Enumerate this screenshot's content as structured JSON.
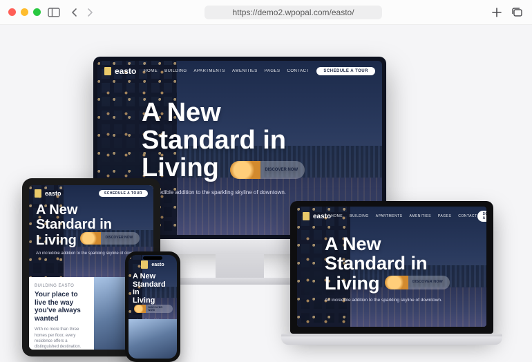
{
  "browser": {
    "url": "https://demo2.wpopal.com/easto/"
  },
  "site": {
    "brand": "easto",
    "nav": [
      "HOME",
      "BUILDING",
      "APARTMENTS",
      "AMENITIES",
      "PAGES",
      "CONTACT"
    ],
    "cta": "SCHEDULE A TOUR",
    "hero_line1": "A New",
    "hero_line2": "Standard in",
    "hero_line3": "Living",
    "discover": "DISCOVER NOW",
    "subtitle": "An incredible addition to the sparkling skyline of downtown.",
    "below": {
      "kicker": "BUILDING EASTO",
      "heading": "Your place to live the way you've always wanted",
      "body": "With no more than three homes per floor, every residence offers a distinguished destination. Each residence is designed with expansive open floor plans and dramatic spaces."
    }
  }
}
